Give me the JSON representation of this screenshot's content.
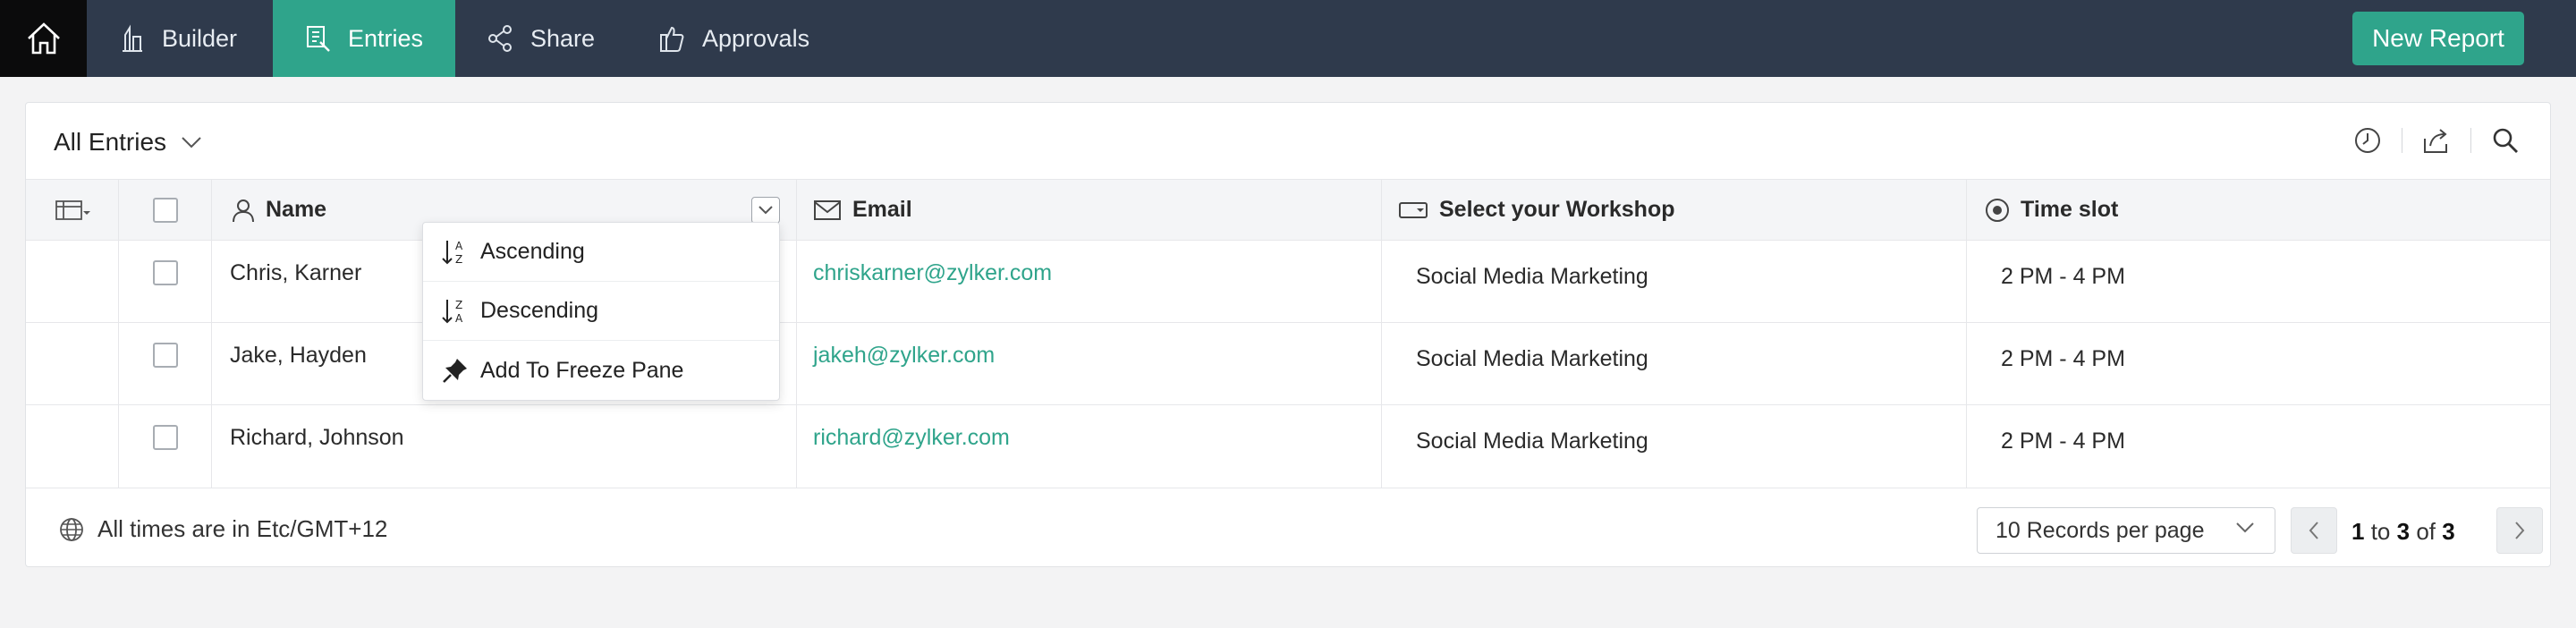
{
  "nav": {
    "tabs": [
      {
        "label": "Builder",
        "icon": "builder-icon"
      },
      {
        "label": "Entries",
        "icon": "entries-icon",
        "active": true
      },
      {
        "label": "Share",
        "icon": "share-icon"
      },
      {
        "label": "Approvals",
        "icon": "approvals-icon"
      }
    ],
    "new_report_label": "New Report"
  },
  "report": {
    "title": "All Entries",
    "toolbar_icons": [
      "clock-icon",
      "export-icon",
      "search-icon"
    ]
  },
  "table": {
    "columns": [
      {
        "label": "Name",
        "icon": "person-icon"
      },
      {
        "label": "Email",
        "icon": "envelope-icon"
      },
      {
        "label": "Select your Workshop",
        "icon": "dropdown-field-icon"
      },
      {
        "label": "Time slot",
        "icon": "radio-icon"
      }
    ],
    "rows": [
      {
        "name": "Chris, Karner",
        "email": "chriskarner@zylker.com",
        "workshop": "Social Media Marketing",
        "time_slot": "2 PM - 4 PM"
      },
      {
        "name": "Jake, Hayden",
        "email": "jakeh@zylker.com",
        "workshop": "Social Media Marketing",
        "time_slot": "2 PM - 4 PM"
      },
      {
        "name": "Richard, Johnson",
        "email": "richard@zylker.com",
        "workshop": "Social Media Marketing",
        "time_slot": "2 PM - 4 PM"
      }
    ]
  },
  "column_menu": {
    "items": [
      {
        "label": "Ascending",
        "icon": "sort-ascending-icon"
      },
      {
        "label": "Descending",
        "icon": "sort-descending-icon"
      },
      {
        "label": "Add To Freeze Pane",
        "icon": "pin-icon"
      }
    ]
  },
  "footer": {
    "timezone_text": "All times are in Etc/GMT+12",
    "records_per_page": "10 Records per page",
    "page_from": "1",
    "page_to_word": "to",
    "page_to": "3",
    "page_of_word": "of",
    "page_total": "3"
  },
  "colors": {
    "topbar": "#2f3a4c",
    "accent": "#2fa48b",
    "home": "#0b0b0c"
  }
}
